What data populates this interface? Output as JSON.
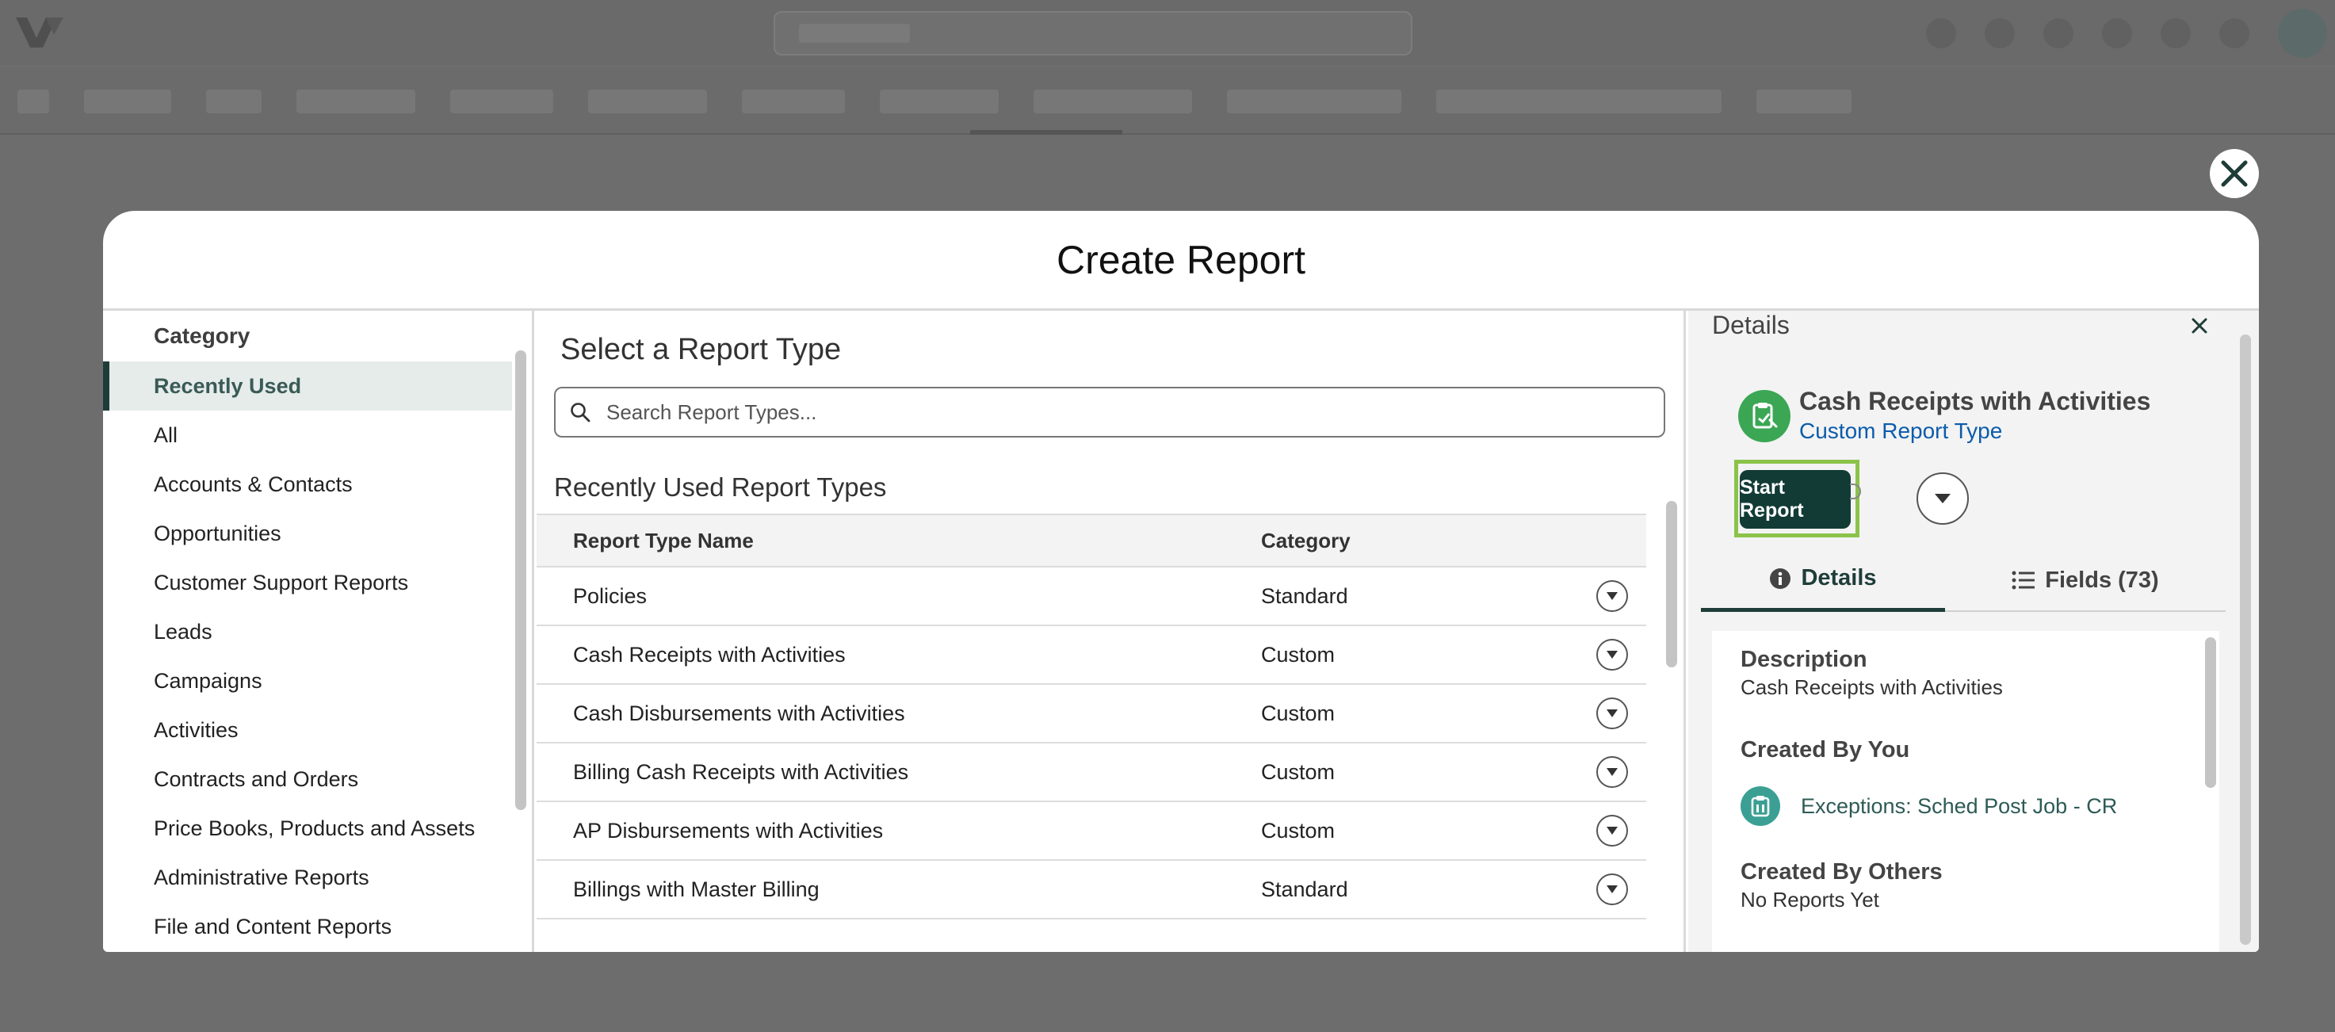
{
  "modal": {
    "title": "Create Report",
    "close_icon": "close-icon"
  },
  "category": {
    "heading": "Category",
    "items": [
      {
        "label": "Recently Used",
        "active": true
      },
      {
        "label": "All"
      },
      {
        "label": "Accounts & Contacts"
      },
      {
        "label": "Opportunities"
      },
      {
        "label": "Customer Support Reports"
      },
      {
        "label": "Leads"
      },
      {
        "label": "Campaigns"
      },
      {
        "label": "Activities"
      },
      {
        "label": "Contracts and Orders"
      },
      {
        "label": "Price Books, Products and Assets"
      },
      {
        "label": "Administrative Reports"
      },
      {
        "label": "File and Content Reports"
      }
    ]
  },
  "report_types": {
    "heading": "Select a Report Type",
    "search_placeholder": "Search Report Types...",
    "recent_heading": "Recently Used Report Types",
    "columns": {
      "name": "Report Type Name",
      "category": "Category"
    },
    "rows": [
      {
        "name": "Policies",
        "category": "Standard"
      },
      {
        "name": "Cash Receipts with Activities",
        "category": "Custom"
      },
      {
        "name": "Cash Disbursements with Activities",
        "category": "Custom"
      },
      {
        "name": "Billing Cash Receipts with Activities",
        "category": "Custom"
      },
      {
        "name": "AP Disbursements with Activities",
        "category": "Custom"
      },
      {
        "name": "Billings with Master Billing",
        "category": "Standard"
      }
    ]
  },
  "details": {
    "title": "Details",
    "report_name": "Cash Receipts with Activities",
    "report_subtype": "Custom Report Type",
    "start_button": "Start Report",
    "tabs": {
      "details": "Details",
      "fields": "Fields (73)"
    },
    "description_heading": "Description",
    "description": "Cash Receipts with Activities",
    "created_by_you_heading": "Created By You",
    "created_by_you_item": "Exceptions: Sched Post Job - CR",
    "created_by_others_heading": "Created By Others",
    "created_by_others_text": "No Reports Yet"
  },
  "colors": {
    "accent_dark": "#123b36",
    "highlight": "#8bc34a",
    "link": "#0b5cab",
    "icon_green": "#3ba755"
  }
}
